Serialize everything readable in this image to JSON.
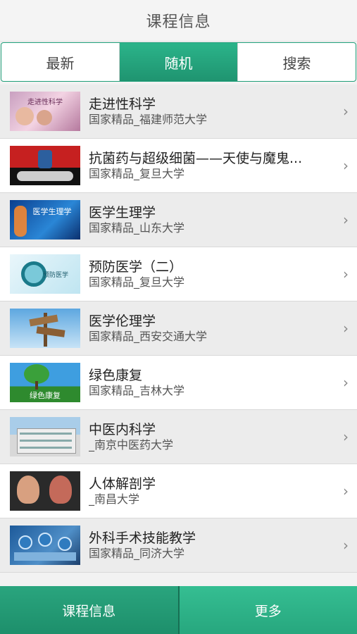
{
  "header": {
    "title": "课程信息"
  },
  "tabs": [
    {
      "label": "最新"
    },
    {
      "label": "随机"
    },
    {
      "label": "搜索"
    }
  ],
  "courses": [
    {
      "name": "走进性科学",
      "source": "国家精品_福建师范大学",
      "thumb_caption": "走进性科学",
      "icon": "people-photo"
    },
    {
      "name": "抗菌药与超级细菌——天使与魔鬼...",
      "source": "国家精品_复旦大学",
      "thumb_caption": "",
      "icon": "badge-photo"
    },
    {
      "name": "医学生理学",
      "source": "国家精品_山东大学",
      "thumb_caption": "医学生理学",
      "icon": "body-scan-photo"
    },
    {
      "name": "预防医学（二）",
      "source": "国家精品_复旦大学",
      "thumb_caption": "预防医学",
      "icon": "shield-logo"
    },
    {
      "name": "医学伦理学",
      "source": "国家精品_西安交通大学",
      "thumb_caption": "",
      "icon": "signpost-photo"
    },
    {
      "name": "绿色康复",
      "source": "国家精品_吉林大学",
      "thumb_caption": "绿色康复",
      "icon": "tree-photo"
    },
    {
      "name": "中医内科学",
      "source": "_南京中医药大学",
      "thumb_caption": "",
      "icon": "building-photo"
    },
    {
      "name": "人体解剖学",
      "source": "_南昌大学",
      "thumb_caption": "",
      "icon": "anatomy-photo"
    },
    {
      "name": "外科手术技能教学",
      "source": "国家精品_同济大学",
      "thumb_caption": "",
      "icon": "surgery-photo"
    }
  ],
  "bottom_nav": [
    {
      "label": "课程信息"
    },
    {
      "label": "更多"
    }
  ],
  "colors": {
    "accent": "#1f9470",
    "accent_light": "#2bb48a"
  }
}
